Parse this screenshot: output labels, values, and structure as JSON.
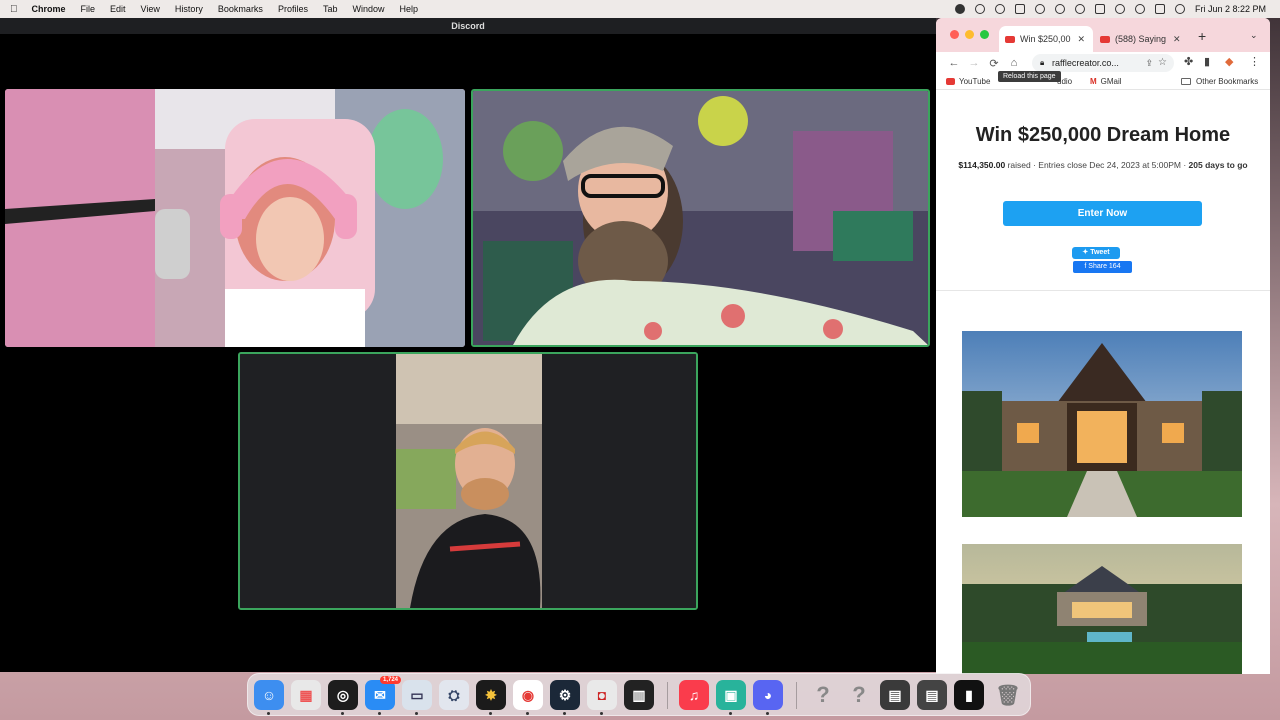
{
  "menubar": {
    "app_name": "Chrome",
    "items": [
      "File",
      "Edit",
      "View",
      "History",
      "Bookmarks",
      "Profiles",
      "Tab",
      "Window",
      "Help"
    ],
    "clock": "Fri Jun 2  8:22 PM"
  },
  "discord": {
    "window_title": "Discord"
  },
  "chrome": {
    "tabs": [
      {
        "title": "Win $250,00",
        "active": true
      },
      {
        "title": "(588) Saying",
        "active": false
      }
    ],
    "url": "rafflecreator.co...",
    "tooltip": "Reload this page",
    "bookmarks": [
      {
        "label": "YouTube",
        "icon": "youtube-icon"
      },
      {
        "label": "udio",
        "icon": ""
      },
      {
        "label": "GMail",
        "icon": "gmail-icon"
      },
      {
        "label": "Other Bookmarks",
        "icon": "folder-icon"
      }
    ]
  },
  "page": {
    "title": "Win $250,000 Dream Home",
    "raised_amount": "$114,350.00",
    "raised_text": " raised · Entries close Dec 24, 2023 at 5:00PM · ",
    "days_to_go": "205 days to go",
    "enter_button": "Enter Now",
    "tweet_button": "Tweet",
    "share_button": "Share 164"
  },
  "dock": {
    "mail_badge": "1,724",
    "apps": [
      "finder",
      "launchpad",
      "obs",
      "mail",
      "preview",
      "xcode-instruments",
      "final-cut",
      "chrome",
      "steam",
      "streamlabs",
      "piano",
      "music",
      "streamdeck",
      "discord",
      "help",
      "help",
      "window",
      "window",
      "terminal",
      "trash"
    ]
  },
  "colors": {
    "speaking_border": "#3ba55d",
    "enter_button": "#1da1f2",
    "tab_strip": "#f6d7dc"
  }
}
